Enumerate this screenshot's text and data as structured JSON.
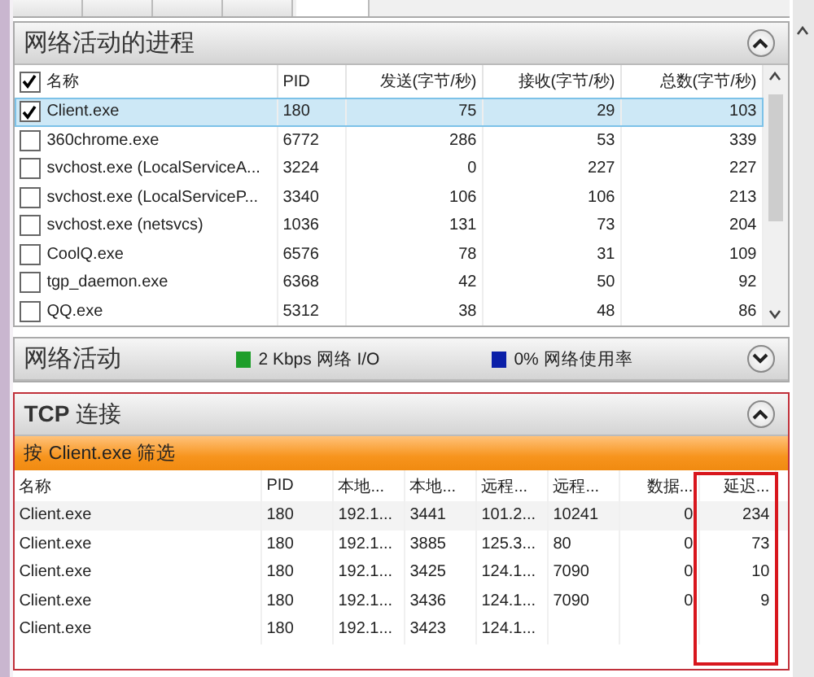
{
  "tabs": [
    {
      "selected": false
    },
    {
      "selected": false
    },
    {
      "selected": false
    },
    {
      "selected": false
    },
    {
      "selected": true
    }
  ],
  "processes": {
    "title": "网络活动的进程",
    "expanded": true,
    "all_checked": true,
    "columns": [
      "名称",
      "PID",
      "发送(字节/秒)",
      "接收(字节/秒)",
      "总数(字节/秒)"
    ],
    "rows": [
      {
        "name": "Client.exe",
        "pid": "180",
        "sent": "75",
        "received": "29",
        "total": "103",
        "checked": true,
        "selected": true
      },
      {
        "name": "360chrome.exe",
        "pid": "6772",
        "sent": "286",
        "received": "53",
        "total": "339",
        "checked": false,
        "selected": false
      },
      {
        "name": "svchost.exe (LocalServiceA...",
        "pid": "3224",
        "sent": "0",
        "received": "227",
        "total": "227",
        "checked": false,
        "selected": false
      },
      {
        "name": "svchost.exe (LocalServiceP...",
        "pid": "3340",
        "sent": "106",
        "received": "106",
        "total": "213",
        "checked": false,
        "selected": false
      },
      {
        "name": "svchost.exe (netsvcs)",
        "pid": "1036",
        "sent": "131",
        "received": "73",
        "total": "204",
        "checked": false,
        "selected": false
      },
      {
        "name": "CoolQ.exe",
        "pid": "6576",
        "sent": "78",
        "received": "31",
        "total": "109",
        "checked": false,
        "selected": false
      },
      {
        "name": "tgp_daemon.exe",
        "pid": "6368",
        "sent": "42",
        "received": "50",
        "total": "92",
        "checked": false,
        "selected": false
      },
      {
        "name": "QQ.exe",
        "pid": "5312",
        "sent": "38",
        "received": "48",
        "total": "86",
        "checked": false,
        "selected": false
      }
    ]
  },
  "network_activity": {
    "title": "网络活动",
    "expanded": false,
    "legend": [
      {
        "label": "2 Kbps 网络 I/O",
        "color": "#1e9e2a"
      },
      {
        "label": "0% 网络使用率",
        "color": "#0a1fa8"
      }
    ]
  },
  "tcp": {
    "title": "**TCP** 连接",
    "expanded": true,
    "filter": "按 Client.exe 筛选",
    "columns": [
      "名称",
      "PID",
      "本地...",
      "本地...",
      "远程...",
      "远程...",
      "数据...",
      "延迟..."
    ],
    "rows": [
      [
        "Client.exe",
        "180",
        "192.1...",
        "3441",
        "101.2...",
        "10241",
        "0",
        "234"
      ],
      [
        "Client.exe",
        "180",
        "192.1...",
        "3885",
        "125.3...",
        "80",
        "0",
        "73"
      ],
      [
        "Client.exe",
        "180",
        "192.1...",
        "3425",
        "124.1...",
        "7090",
        "0",
        "10"
      ],
      [
        "Client.exe",
        "180",
        "192.1...",
        "3436",
        "124.1...",
        "7090",
        "0",
        "9"
      ],
      [
        "Client.exe",
        "180",
        "192.1...",
        "3423",
        "124.1..."
      ]
    ]
  }
}
